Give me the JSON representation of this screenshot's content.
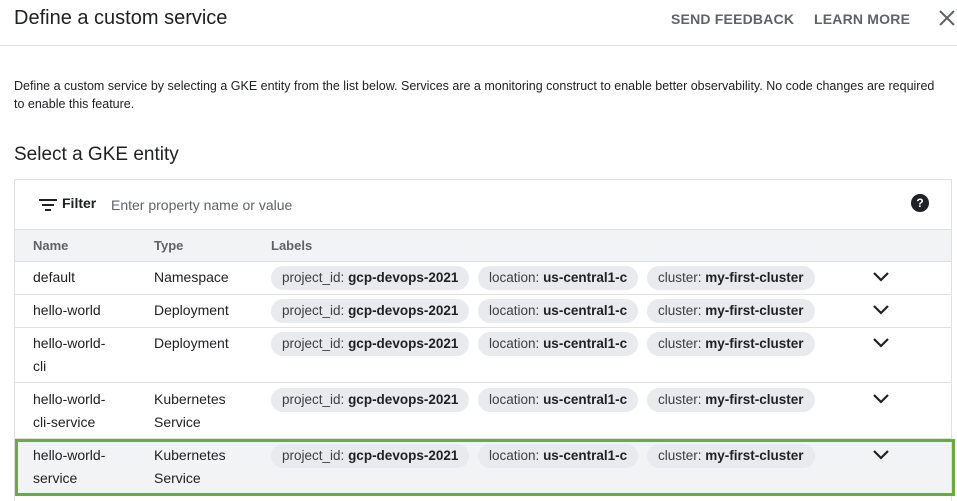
{
  "header": {
    "title": "Define a custom service",
    "send_feedback": "SEND FEEDBACK",
    "learn_more": "LEARN MORE"
  },
  "description": "Define a custom service by selecting a GKE entity from the list below. Services are a monitoring construct to enable better observability. No code changes are required to enable this feature.",
  "section_title": "Select a GKE entity",
  "filter": {
    "label": "Filter",
    "placeholder": "Enter property name or value",
    "help": "?"
  },
  "table": {
    "columns": {
      "name": "Name",
      "type": "Type",
      "labels": "Labels"
    },
    "rows": [
      {
        "name": "default",
        "type": "Namespace",
        "labels": [
          {
            "key": "project_id:",
            "value": "gcp-devops-2021"
          },
          {
            "key": "location:",
            "value": "us-central1-c"
          },
          {
            "key": "cluster:",
            "value": "my-first-cluster"
          }
        ]
      },
      {
        "name": "hello-world",
        "type": "Deployment",
        "labels": [
          {
            "key": "project_id:",
            "value": "gcp-devops-2021"
          },
          {
            "key": "location:",
            "value": "us-central1-c"
          },
          {
            "key": "cluster:",
            "value": "my-first-cluster"
          }
        ]
      },
      {
        "name": "hello-world-cli",
        "type": "Deployment",
        "labels": [
          {
            "key": "project_id:",
            "value": "gcp-devops-2021"
          },
          {
            "key": "location:",
            "value": "us-central1-c"
          },
          {
            "key": "cluster:",
            "value": "my-first-cluster"
          }
        ]
      },
      {
        "name": "hello-world-cli-service",
        "type": "Kubernetes Service",
        "labels": [
          {
            "key": "project_id:",
            "value": "gcp-devops-2021"
          },
          {
            "key": "location:",
            "value": "us-central1-c"
          },
          {
            "key": "cluster:",
            "value": "my-first-cluster"
          }
        ]
      },
      {
        "name": "hello-world-service",
        "type": "Kubernetes Service",
        "selected": true,
        "labels": [
          {
            "key": "project_id:",
            "value": "gcp-devops-2021"
          },
          {
            "key": "location:",
            "value": "us-central1-c"
          },
          {
            "key": "cluster:",
            "value": "my-first-cluster"
          }
        ]
      }
    ]
  },
  "colors": {
    "selection_outline": "#6aab3b",
    "chip_background": "#e8eaed",
    "header_background": "#f1f3f4"
  }
}
